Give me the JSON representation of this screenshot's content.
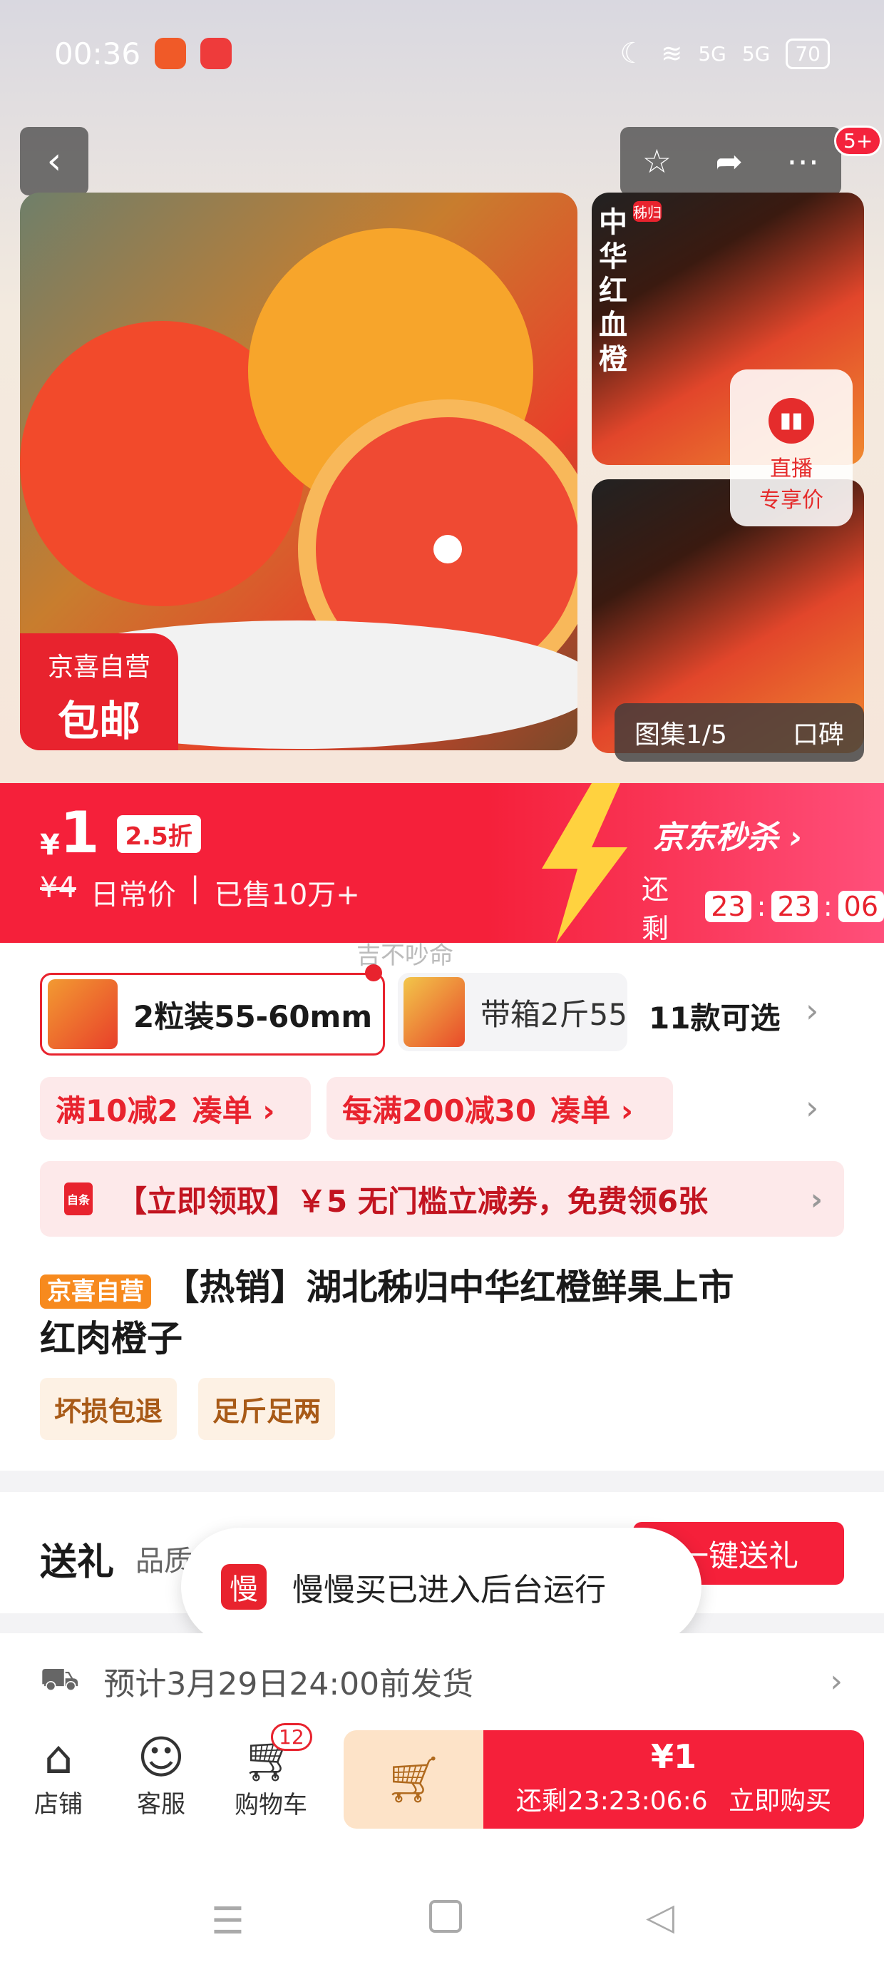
{
  "status": {
    "time": "00:36",
    "battery": "70",
    "signal1": "5G",
    "signal2": "5G"
  },
  "header": {
    "cart_badge": "5+"
  },
  "hero": {
    "thumb_text_vertical": "中华红血橙",
    "thumb_tag": "秭归",
    "live_label1": "直播",
    "live_label2": "专享价",
    "gallery_label": "图集1/5",
    "review_label": "口碑",
    "jx_line1": "京喜自营",
    "jx_line2": "包邮"
  },
  "price": {
    "currency": "¥",
    "value": "1",
    "discount": "2.5折",
    "original": "¥4",
    "original_label": "日常价",
    "sold": "已售10万+",
    "brand": "京东秒杀",
    "remain_label": "还剩",
    "hh": "23",
    "mm": "23",
    "ss": "06"
  },
  "sku": {
    "selected": "2粒装55-60mm",
    "second": "带箱2斤55",
    "count": "11款可选",
    "hint": "吉不吵命"
  },
  "promos": [
    {
      "text": "满10减2",
      "action": "凑单 ›"
    },
    {
      "text": "每满200减30",
      "action": "凑单 ›"
    }
  ],
  "coupon": {
    "icon": "自条",
    "text": "【立即领取】￥5 无门槛立减券，免费领6张"
  },
  "title": {
    "tag": "京喜自营",
    "text_line1": "【热销】湖北秭归中华红橙鲜果上市",
    "text_line2": "红肉橙子"
  },
  "guarantees": [
    "坏损包退",
    "足斤足两"
  ],
  "gift": {
    "label": "送礼",
    "sub": "品质",
    "button": "一键送礼"
  },
  "toast": {
    "icon": "慢",
    "text": "慢慢买已进入后台运行"
  },
  "shipping": {
    "text": "预计3月29日24:00前发货"
  },
  "bottom": {
    "store": "店铺",
    "service": "客服",
    "cart": "购物车",
    "cart_count": "12",
    "buy_price": "¥1",
    "buy_countdown": "还剩23:23:06:6",
    "buy_label": "立即购买"
  },
  "colors": {
    "accent": "#f5203a",
    "promo_bg": "#fde9ea",
    "guarantee_bg": "#fdf1e4"
  }
}
